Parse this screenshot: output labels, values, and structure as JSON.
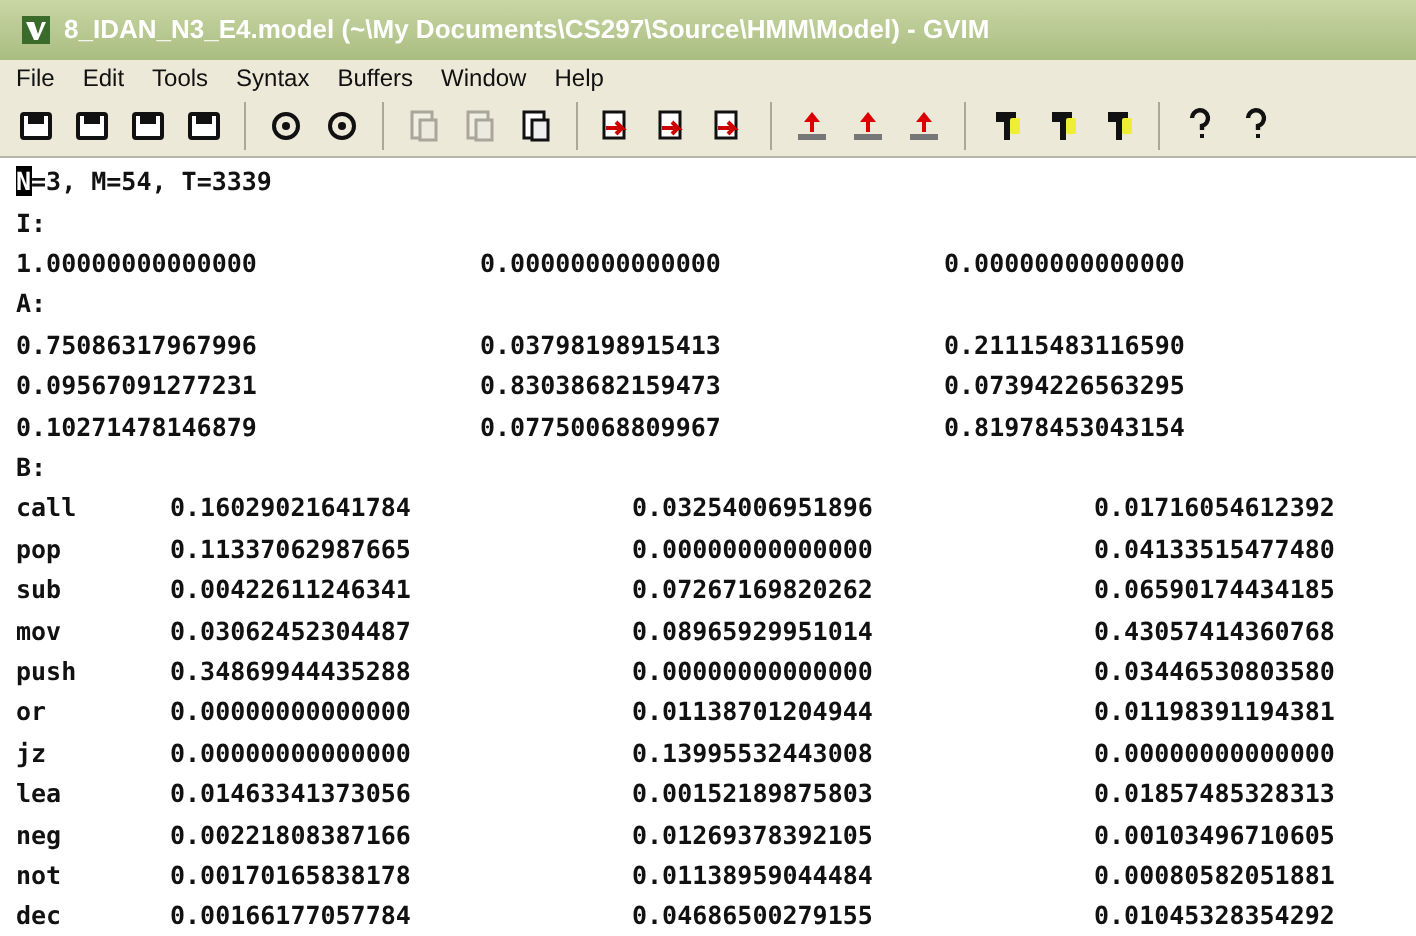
{
  "window": {
    "title": "8_IDAN_N3_E4.model (~\\My Documents\\CS297\\Source\\HMM\\Model) - GVIM"
  },
  "menu": [
    {
      "label": "File"
    },
    {
      "label": "Edit"
    },
    {
      "label": "Tools"
    },
    {
      "label": "Syntax"
    },
    {
      "label": "Buffers"
    },
    {
      "label": "Window"
    },
    {
      "label": "Help"
    }
  ],
  "toolbar_groups": [
    [
      {
        "disabled": false
      },
      {
        "disabled": false
      },
      {
        "disabled": false
      },
      {
        "disabled": false
      }
    ],
    [
      {
        "disabled": false
      },
      {
        "disabled": false
      }
    ],
    [
      {
        "disabled": true
      },
      {
        "disabled": true
      },
      {
        "disabled": false
      }
    ],
    [
      {
        "disabled": false
      },
      {
        "disabled": false
      },
      {
        "disabled": false
      }
    ],
    [
      {
        "disabled": false
      },
      {
        "disabled": false
      },
      {
        "disabled": false
      }
    ],
    [
      {
        "disabled": false
      },
      {
        "disabled": false
      },
      {
        "disabled": false
      }
    ],
    [
      {
        "disabled": false
      },
      {
        "disabled": false
      }
    ]
  ],
  "editor": {
    "lines": [
      {
        "kind": "text",
        "text": "N=3, M=54, T=3339",
        "cursor": true
      },
      {
        "kind": "text",
        "text": "I:",
        "cursor": false
      },
      {
        "kind": "matrix",
        "values": [
          "1.00000000000000",
          "0.00000000000000",
          "0.00000000000000"
        ]
      },
      {
        "kind": "text",
        "text": "A:",
        "cursor": false
      },
      {
        "kind": "matrix",
        "values": [
          "0.75086317967996",
          "0.03798198915413",
          "0.21115483116590"
        ]
      },
      {
        "kind": "matrix",
        "values": [
          "0.09567091277231",
          "0.83038682159473",
          "0.07394226563295"
        ]
      },
      {
        "kind": "matrix",
        "values": [
          "0.10271478146879",
          "0.07750068809967",
          "0.81978453043154"
        ]
      },
      {
        "kind": "text",
        "text": "B:",
        "cursor": false
      },
      {
        "kind": "labeled",
        "label": "call",
        "values": [
          "0.16029021641784",
          "0.03254006951896",
          "0.01716054612392"
        ]
      },
      {
        "kind": "labeled",
        "label": "pop",
        "values": [
          "0.11337062987665",
          "0.00000000000000",
          "0.04133515477480"
        ]
      },
      {
        "kind": "labeled",
        "label": "sub",
        "values": [
          "0.00422611246341",
          "0.07267169820262",
          "0.06590174434185"
        ]
      },
      {
        "kind": "labeled",
        "label": "mov",
        "values": [
          "0.03062452304487",
          "0.08965929951014",
          "0.43057414360768"
        ]
      },
      {
        "kind": "labeled",
        "label": "push",
        "values": [
          "0.34869944435288",
          "0.00000000000000",
          "0.03446530803580"
        ]
      },
      {
        "kind": "labeled",
        "label": "or",
        "values": [
          "0.00000000000000",
          "0.01138701204944",
          "0.01198391194381"
        ]
      },
      {
        "kind": "labeled",
        "label": "jz",
        "values": [
          "0.00000000000000",
          "0.13995532443008",
          "0.00000000000000"
        ]
      },
      {
        "kind": "labeled",
        "label": "lea",
        "values": [
          "0.01463341373056",
          "0.00152189875803",
          "0.01857485328313"
        ]
      },
      {
        "kind": "labeled",
        "label": "neg",
        "values": [
          "0.00221808387166",
          "0.01269378392105",
          "0.00103496710605"
        ]
      },
      {
        "kind": "labeled",
        "label": "not",
        "values": [
          "0.00170165838178",
          "0.01138959044484",
          "0.00080582051881"
        ]
      },
      {
        "kind": "labeled",
        "label": "dec",
        "values": [
          "0.00166177057784",
          "0.04686500279155",
          "0.01045328354292"
        ]
      }
    ]
  }
}
